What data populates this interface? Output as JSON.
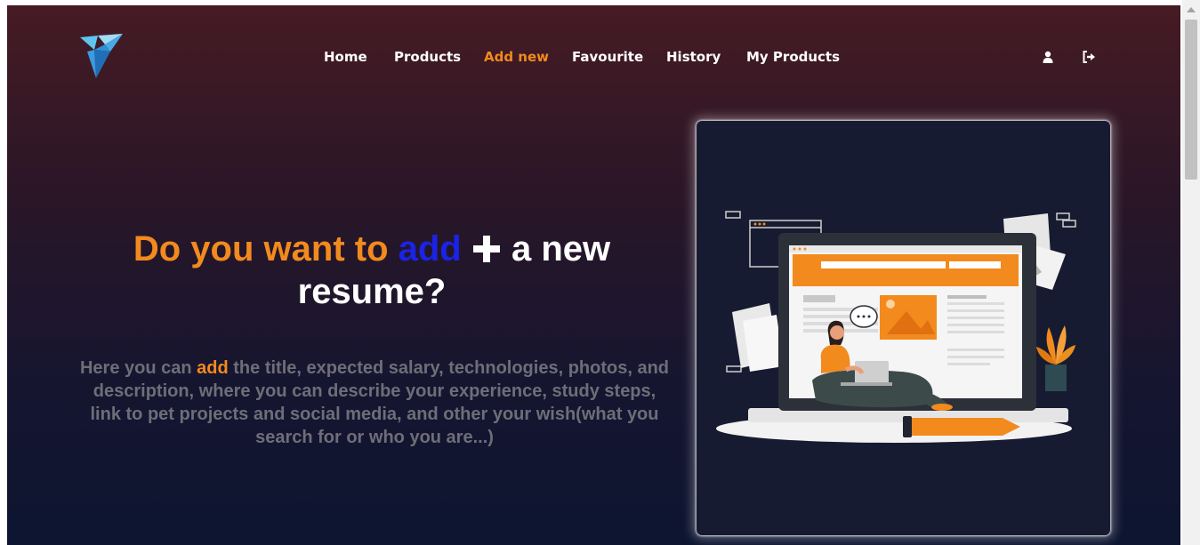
{
  "nav": {
    "items": [
      {
        "label": "Home",
        "active": false
      },
      {
        "label": "Products",
        "active": false
      },
      {
        "label": "Add new",
        "active": true
      },
      {
        "label": "Favourite",
        "active": false
      },
      {
        "label": "History",
        "active": false
      },
      {
        "label": "My Products",
        "active": false
      }
    ],
    "icons": [
      "user-icon",
      "logout-icon"
    ]
  },
  "hero": {
    "headline_part1": "Do you want to ",
    "headline_part2": "add",
    "headline_part3": " a new",
    "headline_part4": "resume?",
    "description_prefix": "Here you can ",
    "description_highlight": "add",
    "description_rest": " the title, expected salary, technologies, photos, and description, where you can describe your experience, study steps, link to pet projects and social media, and other your wish(what you search for or who you are...)"
  },
  "colors": {
    "accent_orange": "#f28a1e",
    "accent_blue": "#1a23e6",
    "nav_text": "#ffffff",
    "description_gray": "#6e6e78",
    "bg_top": "#461b24",
    "bg_bottom": "#0d1530"
  },
  "illustration": {
    "name": "person-with-laptop-illustration"
  }
}
